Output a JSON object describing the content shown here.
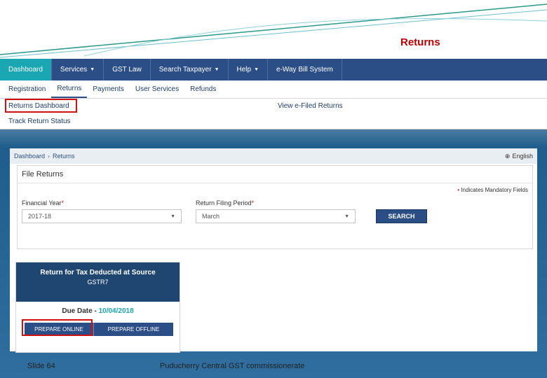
{
  "slide": {
    "title": "Returns",
    "footer_left": "Slide 64",
    "footer_center": "Puducherry Central GST commissionerate"
  },
  "nav": {
    "items": [
      {
        "label": "Dashboard"
      },
      {
        "label": "Services"
      },
      {
        "label": "GST Law"
      },
      {
        "label": "Search Taxpayer"
      },
      {
        "label": "Help"
      },
      {
        "label": "e-Way Bill System"
      }
    ]
  },
  "subnav": {
    "items": [
      {
        "label": "Registration"
      },
      {
        "label": "Returns"
      },
      {
        "label": "Payments"
      },
      {
        "label": "User Services"
      },
      {
        "label": "Refunds"
      }
    ],
    "menu": {
      "returns_dashboard": "Returns Dashboard",
      "track_return_status": "Track Return Status",
      "view_efiled_returns": "View e-Filed Returns"
    }
  },
  "breadcrumb": {
    "home": "Dashboard",
    "current": "Returns",
    "language": "English"
  },
  "file_returns": {
    "title": "File Returns",
    "mandatory_note": "Indicates Mandatory Fields",
    "financial_year_label": "Financial Year",
    "financial_year_value": "2017-18",
    "period_label": "Return Filing Period",
    "period_value": "March",
    "search_label": "SEARCH"
  },
  "card": {
    "title": "Return for Tax Deducted at Source",
    "code": "GSTR7",
    "due_label": "Due Date -",
    "due_date": "10/04/2018",
    "prepare_online": "PREPARE ONLINE",
    "prepare_offline": "PREPARE OFFLINE"
  },
  "colors": {
    "nav_bg": "#2c4e86",
    "active_tab": "#1aa7b3",
    "highlight": "#d11010",
    "slide_title": "#c00000"
  }
}
